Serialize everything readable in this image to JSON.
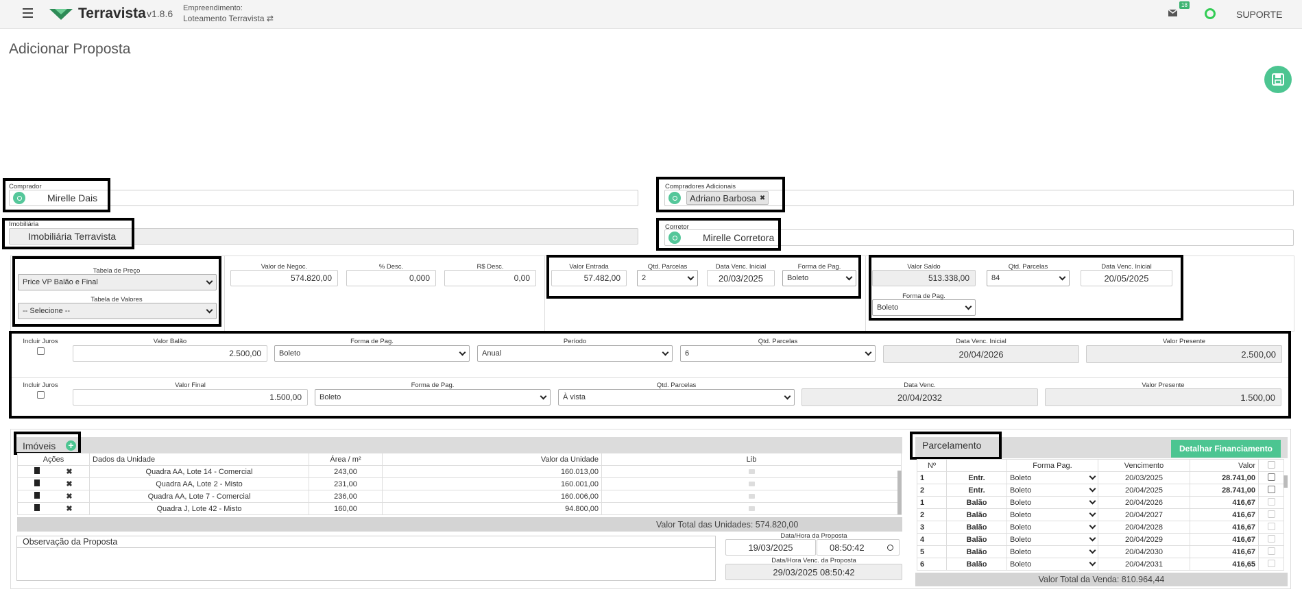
{
  "app": {
    "brand": "Terravista",
    "version": "v1.8.6",
    "emp_label": "Empreendimento:",
    "emp_value": "Loteamento Terravista ⇄",
    "mail_count": "18",
    "support": "SUPORTE"
  },
  "page": {
    "title": "Adicionar Proposta"
  },
  "comprador": {
    "label": "Comprador",
    "value": "Mirelle Dais"
  },
  "adicionais": {
    "label": "Compradores Adicionais",
    "chip": "Adriano Barbosa",
    "chip_x": "✖"
  },
  "imobiliaria": {
    "label": "Imobiliária",
    "value": "Imobiliária Terravista"
  },
  "corretor": {
    "label": "Corretor",
    "value": "Mirelle Corretora"
  },
  "tabela": {
    "preco_label": "Tabela de Preço",
    "preco_value": "Price VP Balão e Final",
    "valores_label": "Tabela de Valores",
    "valores_value": "-- Selecione --"
  },
  "negoc": {
    "valor_label": "Valor de Negoc.",
    "valor": "574.820,00",
    "pdesc_label": "% Desc.",
    "pdesc": "0,000",
    "rdesc_label": "R$ Desc.",
    "rdesc": "0,00"
  },
  "entrada": {
    "valor_label": "Valor Entrada",
    "valor": "57.482,00",
    "qtd_label": "Qtd. Parcelas",
    "qtd": "2",
    "data_label": "Data Venc. Inicial",
    "data": "20/03/2025",
    "forma_label": "Forma de Pag.",
    "forma": "Boleto"
  },
  "saldo": {
    "valor_label": "Valor Saldo",
    "valor": "513.338,00",
    "qtd_label": "Qtd. Parcelas",
    "qtd": "84",
    "data_label": "Data Venc. Inicial",
    "data": "20/05/2025",
    "forma_label": "Forma de Pag.",
    "forma": "Boleto"
  },
  "balao": {
    "juros_label": "Incluir Juros",
    "valor_label": "Valor Balão",
    "valor": "2.500,00",
    "forma_label": "Forma de Pag.",
    "forma": "Boleto",
    "periodo_label": "Período",
    "periodo": "Anual",
    "qtd_label": "Qtd. Parcelas",
    "qtd": "6",
    "data_label": "Data Venc. Inicial",
    "data": "20/04/2026",
    "vp_label": "Valor Presente",
    "vp": "2.500,00"
  },
  "final": {
    "juros_label": "Incluir Juros",
    "valor_label": "Valor Final",
    "valor": "1.500,00",
    "forma_label": "Forma de Pag.",
    "forma": "Boleto",
    "qtd_label": "Qtd. Parcelas",
    "qtd": "À vista",
    "data_label": "Data Venc.",
    "data": "20/04/2032",
    "vp_label": "Valor Presente",
    "vp": "1.500,00"
  },
  "imoveis": {
    "title": "Imóveis",
    "headers": [
      "Ações",
      "Dados da Unidade",
      "Área / m²",
      "Valor da Unidade",
      "Lib"
    ],
    "rows": [
      {
        "dados": "Quadra AA, Lote 14 - Comercial",
        "area": "243,00",
        "valor": "160.013,00"
      },
      {
        "dados": "Quadra AA, Lote 2 - Misto",
        "area": "231,00",
        "valor": "160.001,00"
      },
      {
        "dados": "Quadra AA, Lote 7 - Comercial",
        "area": "236,00",
        "valor": "160.006,00"
      },
      {
        "dados": "Quadra J, Lote 42 - Misto",
        "area": "160,00",
        "valor": "94.800,00"
      }
    ],
    "total": "Valor Total das Unidades: 574.820,00"
  },
  "obs": {
    "label": "Observação da Proposta"
  },
  "proposta": {
    "data_label": "Data/Hora da Proposta",
    "data": "19/03/2025",
    "hora": "08:50:42",
    "venc_label": "Data/Hora Venc. da Proposta",
    "venc": "29/03/2025 08:50:42"
  },
  "parcelamento": {
    "title": "Parcelamento",
    "detalhar": "Detalhar Financiamento",
    "headers": [
      "Nº",
      "",
      "Forma Pag.",
      "Vencimento",
      "Valor"
    ],
    "rows": [
      {
        "n": "1",
        "tipo": "Entr.",
        "forma": "Boleto",
        "venc": "20/03/2025",
        "valor": "28.741,00"
      },
      {
        "n": "2",
        "tipo": "Entr.",
        "forma": "Boleto",
        "venc": "20/04/2025",
        "valor": "28.741,00"
      },
      {
        "n": "1",
        "tipo": "Balão",
        "forma": "Boleto",
        "venc": "20/04/2026",
        "valor": "416,67"
      },
      {
        "n": "2",
        "tipo": "Balão",
        "forma": "Boleto",
        "venc": "20/04/2027",
        "valor": "416,67"
      },
      {
        "n": "3",
        "tipo": "Balão",
        "forma": "Boleto",
        "venc": "20/04/2028",
        "valor": "416,67"
      },
      {
        "n": "4",
        "tipo": "Balão",
        "forma": "Boleto",
        "venc": "20/04/2029",
        "valor": "416,67"
      },
      {
        "n": "5",
        "tipo": "Balão",
        "forma": "Boleto",
        "venc": "20/04/2030",
        "valor": "416,67"
      },
      {
        "n": "6",
        "tipo": "Balão",
        "forma": "Boleto",
        "venc": "20/04/2031",
        "valor": "416,65"
      }
    ],
    "total": "Valor Total da Venda: 810.964,44"
  }
}
